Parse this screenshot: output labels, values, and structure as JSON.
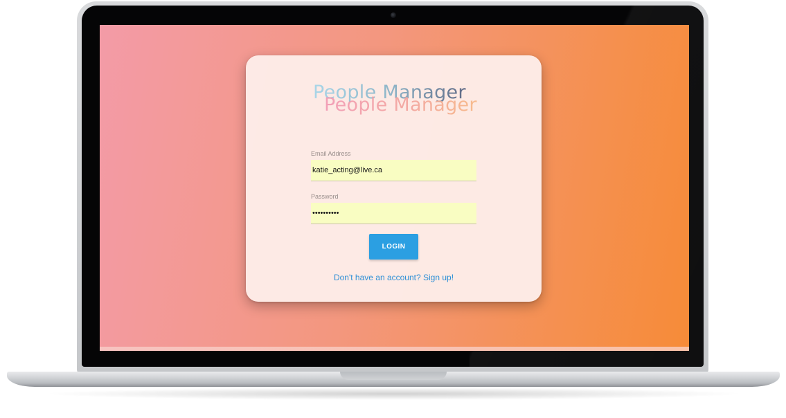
{
  "app": {
    "logo_text_back": "People Manager",
    "logo_text_front": "People Manager"
  },
  "login_form": {
    "email": {
      "label": "Email Address",
      "value": "katie_acting@live.ca"
    },
    "password": {
      "label": "Password",
      "value": "••••••••••"
    },
    "login_button_label": "LOGIN",
    "signup_link_text": "Don't have an account? Sign up!"
  },
  "colors": {
    "background_gradient_start": "#f39ba7",
    "background_gradient_end": "#f68b38",
    "card_background": "#fdece8",
    "input_autofill_background": "#f9fdc2",
    "button_primary": "#2b9fe2",
    "link": "#2d8fd6"
  },
  "icons": {
    "camera": "webcam-icon"
  }
}
